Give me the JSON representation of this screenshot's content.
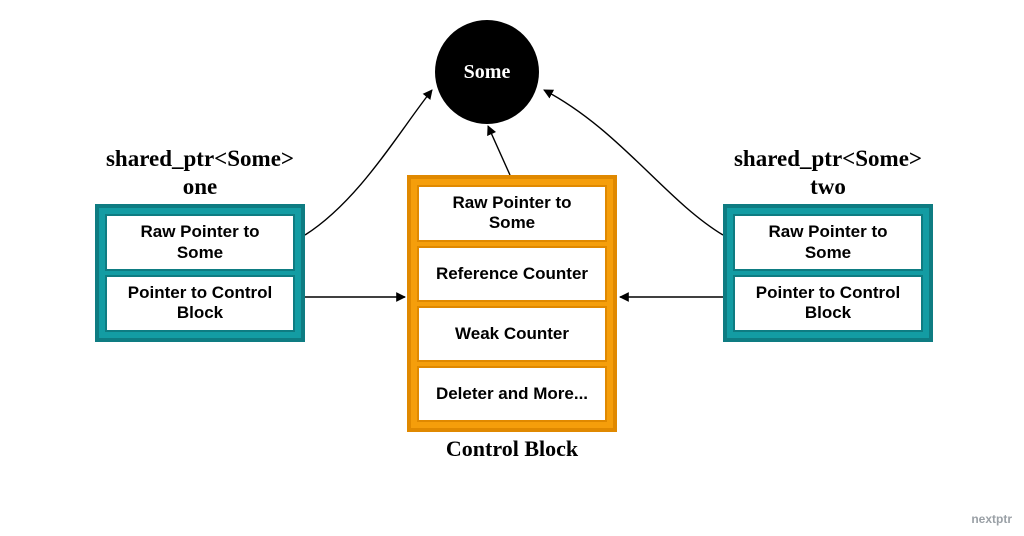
{
  "object": {
    "label": "Some"
  },
  "sharedPtrs": [
    {
      "type": "shared_ptr<Some>",
      "name": "one",
      "fields": [
        "Raw Pointer to Some",
        "Pointer to Control Block"
      ]
    },
    {
      "type": "shared_ptr<Some>",
      "name": "two",
      "fields": [
        "Raw Pointer to Some",
        "Pointer to Control Block"
      ]
    }
  ],
  "controlBlock": {
    "title": "Control Block",
    "fields": [
      "Raw Pointer to Some",
      "Reference Counter",
      "Weak Counter",
      "Deleter and More..."
    ]
  },
  "watermark": "nextptr",
  "colors": {
    "teal": "#139ca3",
    "orange": "#f59e0b",
    "black": "#000000"
  }
}
